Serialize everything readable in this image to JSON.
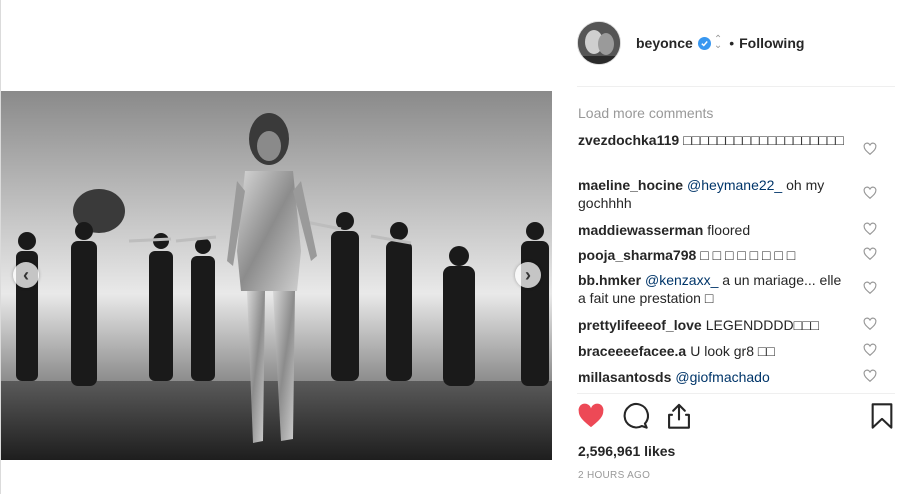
{
  "post": {
    "username": "beyonce",
    "follow_status": "Following",
    "separator": "•",
    "verified_icon": "verified-badge-icon",
    "accent_color": "#3897f0",
    "like_color": "#ed4956"
  },
  "comments_section": {
    "load_more_label": "Load more comments",
    "comments": [
      {
        "user": "zvezdochka119",
        "text": "□□□□□□□□□□□□□□□□□□□"
      },
      {
        "user": "maeline_hocine",
        "mention": "@heymane22_",
        "text": " oh my gochhhh"
      },
      {
        "user": "maddiewasserman",
        "text": "floored"
      },
      {
        "user": "pooja_sharma798",
        "text": "□ □ □ □ □ □ □ □"
      },
      {
        "user": "bb.hmker",
        "mention": "@kenzaxx_",
        "text": " a un mariage... elle a fait une prestation □"
      },
      {
        "user": "prettylifeeeof_love",
        "text": "LEGENDDDD□□□"
      },
      {
        "user": "braceeeefacee.a",
        "text": "U look gr8 □□"
      },
      {
        "user": "millasantosds",
        "mention": "@giofmachado",
        "text": ""
      }
    ]
  },
  "engagement": {
    "likes": "2,596,961 likes",
    "timestamp": "2 HOURS AGO",
    "liked": true
  },
  "carousel": {
    "prev_glyph": "‹",
    "next_glyph": "›"
  }
}
